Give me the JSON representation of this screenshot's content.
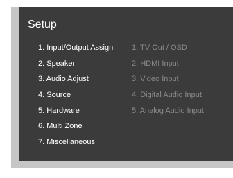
{
  "setup": {
    "title": "Setup",
    "main_items": [
      {
        "label": "1. Input/Output Assign"
      },
      {
        "label": "2. Speaker"
      },
      {
        "label": "3. Audio Adjust"
      },
      {
        "label": "4. Source"
      },
      {
        "label": "5. Hardware"
      },
      {
        "label": "6. Multi Zone"
      },
      {
        "label": "7. Miscellaneous"
      }
    ],
    "sub_items": [
      {
        "label": "1. TV Out / OSD"
      },
      {
        "label": "2. HDMI Input"
      },
      {
        "label": "3. Video Input"
      },
      {
        "label": "4. Digital Audio Input"
      },
      {
        "label": "5. Analog Audio Input"
      }
    ]
  },
  "colors": {
    "screen_background": "#3b3b3b",
    "bezel": "#c6c6c6",
    "active_text": "#ffffff",
    "dimmed_text": "#8a8a8a"
  }
}
